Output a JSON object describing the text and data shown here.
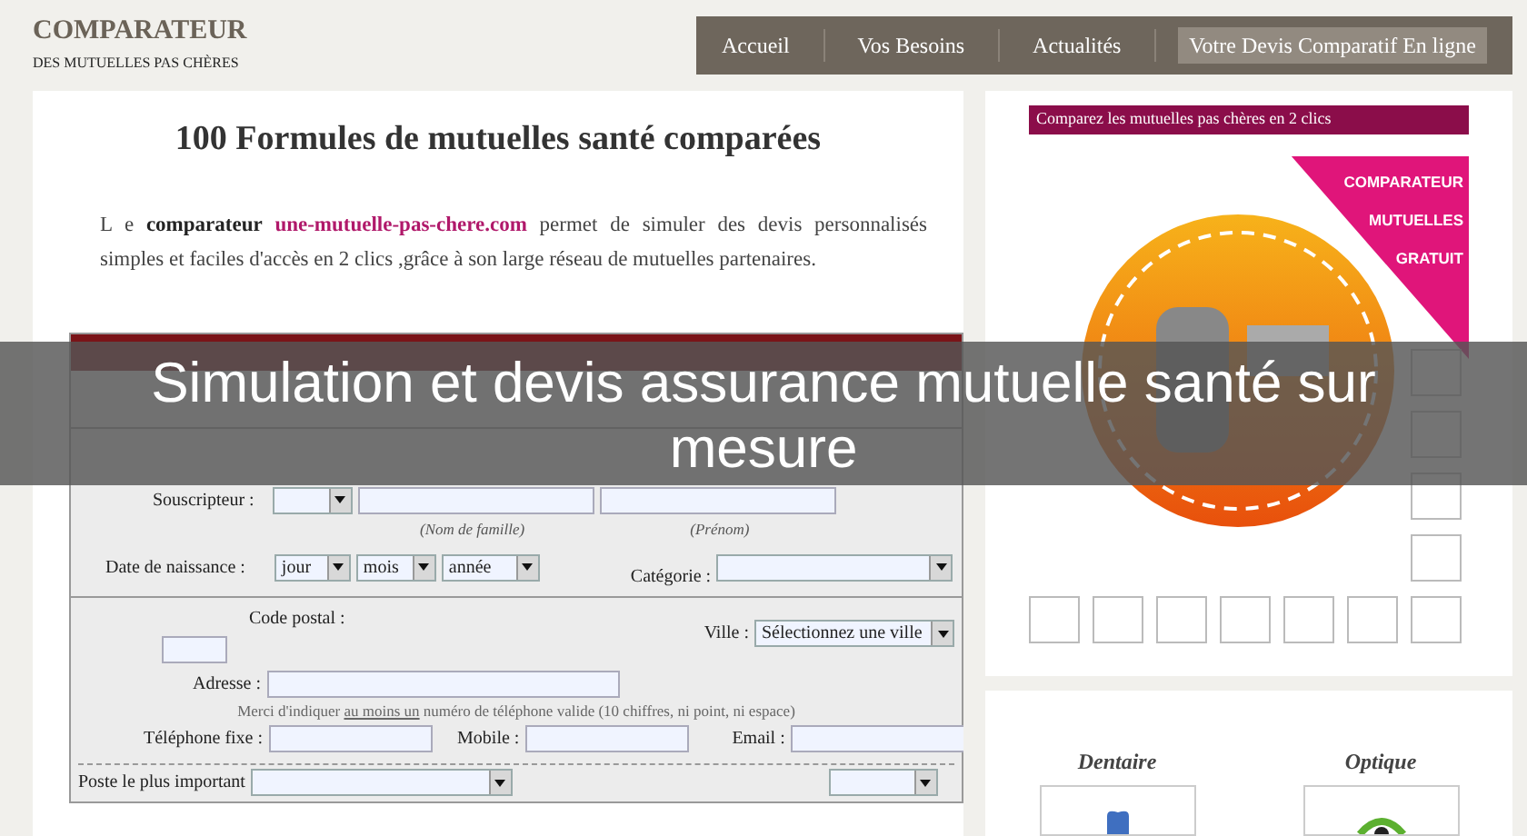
{
  "header": {
    "logo_title": "COMPARATEUR",
    "logo_subtitle": "DES MUTUELLES PAS CHÈRES"
  },
  "nav": [
    {
      "label": "Accueil",
      "selected": false
    },
    {
      "label": "Vos Besoins",
      "selected": false
    },
    {
      "label": "Actualités",
      "selected": false
    },
    {
      "label": "Votre Devis Comparatif En ligne",
      "selected": true
    }
  ],
  "main": {
    "heading": "100 Formules de mutuelles santé comparées",
    "intro_before": "L e **comparateur** ",
    "intro_link": "une-mutuelle-pas-chere.com",
    "intro_after": " permet de simuler des devis personnalisés simples et faciles d'accès en 2 clics ,grâce à son large réseau de mutuelles partenaires."
  },
  "form": {
    "subscriber_label": "Souscripteur :",
    "last_name_hint": "(Nom de famille)",
    "first_name_hint": "(Prénom)",
    "birth_label": "Date de naissance :",
    "day": "jour",
    "month": "mois",
    "year": "année",
    "category_label": "Catégorie :",
    "postcode_label": "Code postal :",
    "city_label": "Ville :",
    "city": "Sélectionnez une ville",
    "address_label": "Adresse :",
    "note_before": "Merci d'indiquer ",
    "note_underlined": "au moins un",
    "note_after": " numéro de téléphone valide (10 chiffres, ni point, ni espace)",
    "phone_label": "Téléphone fixe :",
    "mobile_label": "Mobile :",
    "email_label": "Email :",
    "priority_label": "Poste le plus important"
  },
  "ad": {
    "banner": "Comparez les mutuelles pas chères en 2 clics",
    "corner_lines": [
      "COMPARATEUR",
      "MUTUELLES",
      "GRATUIT"
    ]
  },
  "categories": [
    {
      "label": "Dentaire",
      "kind": "tooth"
    },
    {
      "label": "Optique",
      "kind": "eye"
    }
  ],
  "caption": "Simulation et devis assurance mutuelle santé sur mesure"
}
